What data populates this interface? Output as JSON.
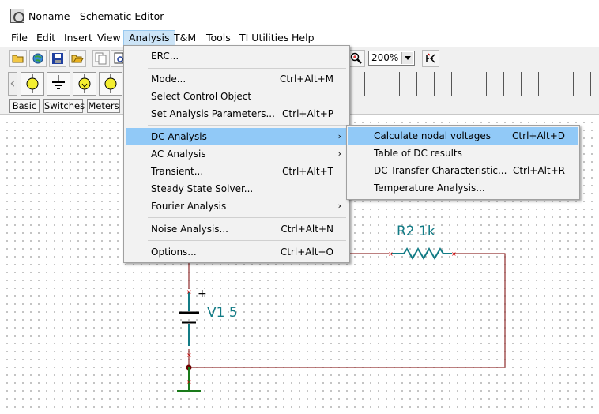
{
  "window": {
    "title": "Noname - Schematic Editor",
    "icon": "app-icon"
  },
  "menubar": [
    "File",
    "Edit",
    "Insert",
    "View",
    "Analysis",
    "T&M",
    "Tools",
    "TI Utilities",
    "Help"
  ],
  "toolbar": {
    "zoom": "200%"
  },
  "category_tabs": [
    "Basic",
    "Switches",
    "Meters"
  ],
  "analysis_menu": {
    "items": [
      {
        "label": "ERC...",
        "shortcut": ""
      },
      {
        "label": "Mode...",
        "shortcut": "Ctrl+Alt+M"
      },
      {
        "label": "Select Control Object",
        "shortcut": ""
      },
      {
        "label": "Set Analysis Parameters...",
        "shortcut": "Ctrl+Alt+P"
      },
      {
        "label": "DC Analysis",
        "shortcut": "",
        "submenu": true,
        "highlighted": true
      },
      {
        "label": "AC Analysis",
        "shortcut": "",
        "submenu": true
      },
      {
        "label": "Transient...",
        "shortcut": "Ctrl+Alt+T"
      },
      {
        "label": "Steady State Solver...",
        "shortcut": ""
      },
      {
        "label": "Fourier Analysis",
        "shortcut": "",
        "submenu": true
      },
      {
        "label": "Noise Analysis...",
        "shortcut": "Ctrl+Alt+N"
      },
      {
        "label": "Options...",
        "shortcut": "Ctrl+Alt+O"
      }
    ]
  },
  "dc_submenu": {
    "items": [
      {
        "label": "Calculate nodal voltages",
        "shortcut": "Ctrl+Alt+D",
        "highlighted": true
      },
      {
        "label": "Table of DC results",
        "shortcut": ""
      },
      {
        "label": "DC Transfer Characteristic...",
        "shortcut": "Ctrl+Alt+R"
      },
      {
        "label": "Temperature Analysis...",
        "shortcut": ""
      }
    ]
  },
  "schematic": {
    "resistor_label": "R2 1k",
    "source_label": "V1 5",
    "plus_sign": "+"
  },
  "submenu_arrow": "›",
  "colors": {
    "menu_highlight": "#91c9f7",
    "wire": "#7a0000",
    "component": "#127b85",
    "ground": "#1a7a1a"
  }
}
